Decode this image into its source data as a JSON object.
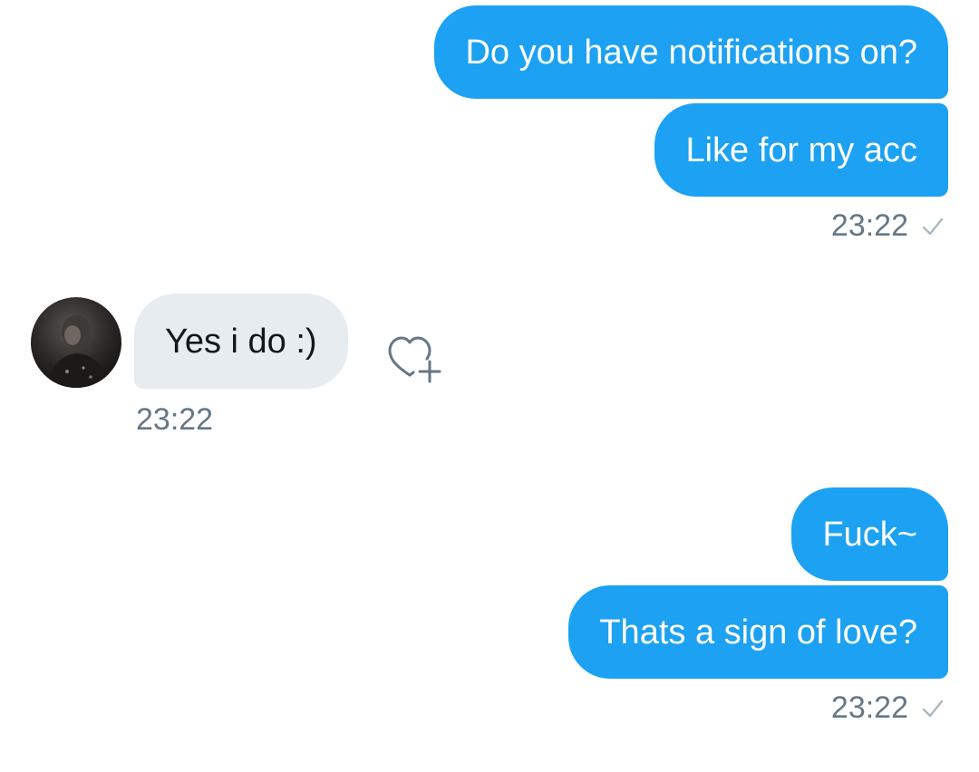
{
  "messages": [
    {
      "text": "Do you have notifications on?",
      "sender": "me"
    },
    {
      "text": "Like for my acc",
      "sender": "me"
    },
    {
      "text": "Yes i do :)",
      "sender": "them"
    },
    {
      "text": "Fuck~",
      "sender": "me"
    },
    {
      "text": "Thats a sign of love?",
      "sender": "me"
    }
  ],
  "timestamps": {
    "group1": "23:22",
    "group2": "23:22",
    "group3": "23:22"
  },
  "colors": {
    "outgoing_bubble": "#1da1f2",
    "incoming_bubble": "#e6ecf0",
    "timestamp": "#657786",
    "checkmark": "#aab8c2"
  },
  "icons": {
    "read_receipt": "check-icon",
    "like": "heart-plus-icon"
  }
}
